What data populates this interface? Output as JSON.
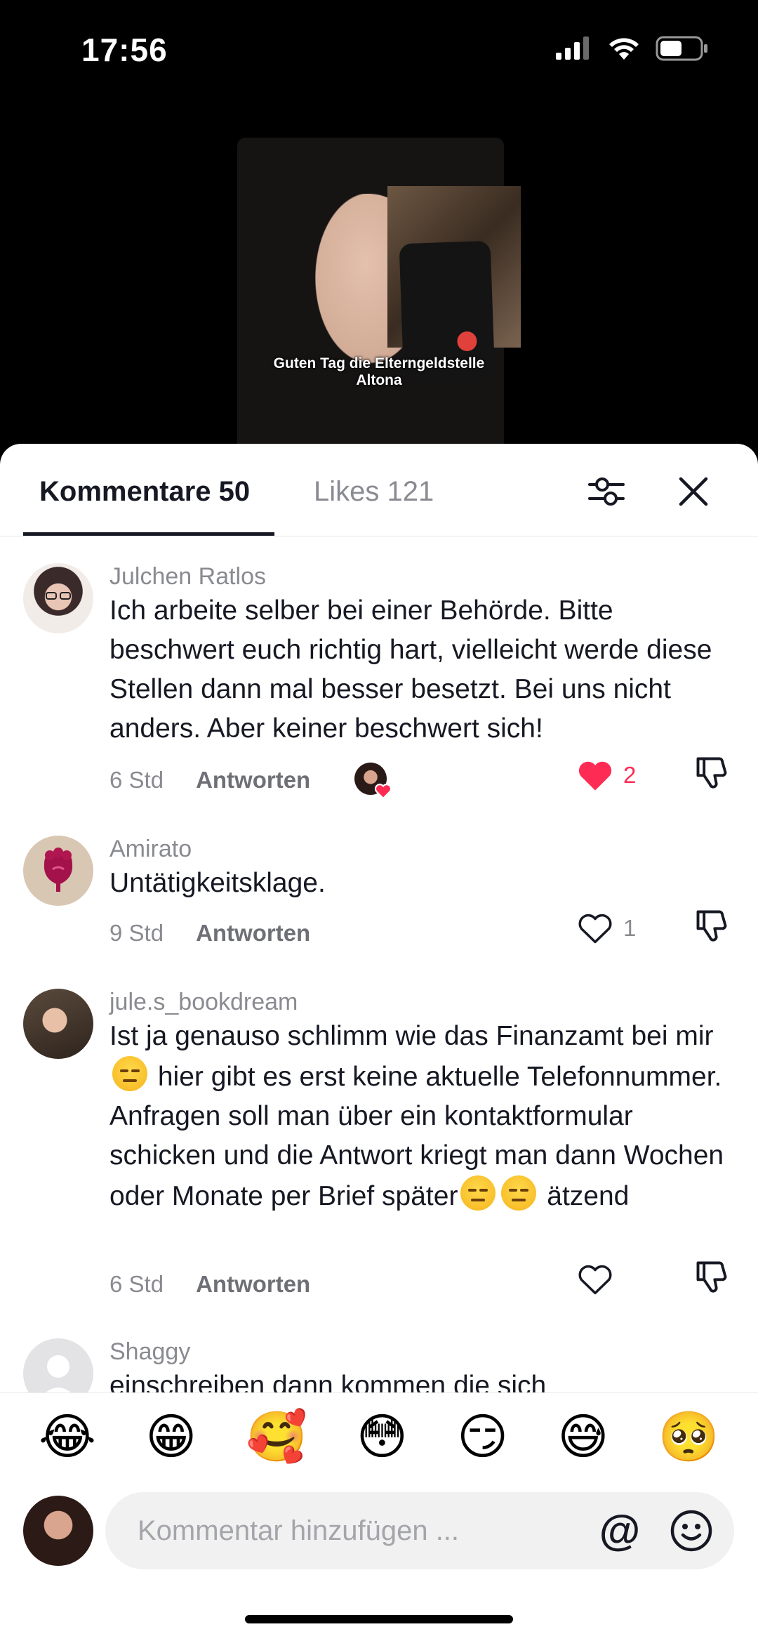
{
  "status_bar": {
    "time": "17:56"
  },
  "video": {
    "caption_line1": "Guten Tag die Elterngeldstelle",
    "caption_line2": "Altona"
  },
  "tabs": {
    "comments_label": "Kommentare 50",
    "likes_label": "Likes 121"
  },
  "comments": [
    {
      "user": "Julchen Ratlos",
      "text": "Ich arbeite selber bei einer Behörde. Bitte beschwert euch richtig hart, vielleicht werde diese Stellen dann mal besser besetzt. Bei uns nicht anders. Aber keiner beschwert sich!",
      "time": "6 Std",
      "reply": "Antworten",
      "likes": "2",
      "liked": true,
      "creator_liked": true
    },
    {
      "user": "Amirato",
      "text": "Untätigkeitsklage.",
      "time": "9 Std",
      "reply": "Antworten",
      "likes": "1",
      "liked": false
    },
    {
      "user": "jule.s_bookdream",
      "text_part1": "Ist ja genauso schlimm wie das Finanzamt bei mir",
      "text_part2": " hier gibt es erst keine aktuelle Telefonnummer. Anfragen soll man über ein kontaktformular schicken und die Antwort kriegt man dann Wochen oder Monate per Brief später",
      "text_part3": " ätzend",
      "time": "6 Std",
      "reply": "Antworten",
      "likes": "",
      "liked": false
    },
    {
      "user": "Shaggy",
      "text": "einschreiben dann kommen die sich"
    }
  ],
  "quick_emojis": [
    "😂",
    "😁",
    "🥰",
    "😳",
    "😏",
    "😅",
    "🥺"
  ],
  "input": {
    "placeholder": "Kommentar hinzufügen ...",
    "at_symbol": "@"
  },
  "colors": {
    "like_red": "#fe2c55",
    "text_primary": "#161823",
    "text_secondary": "#8a8b91"
  }
}
